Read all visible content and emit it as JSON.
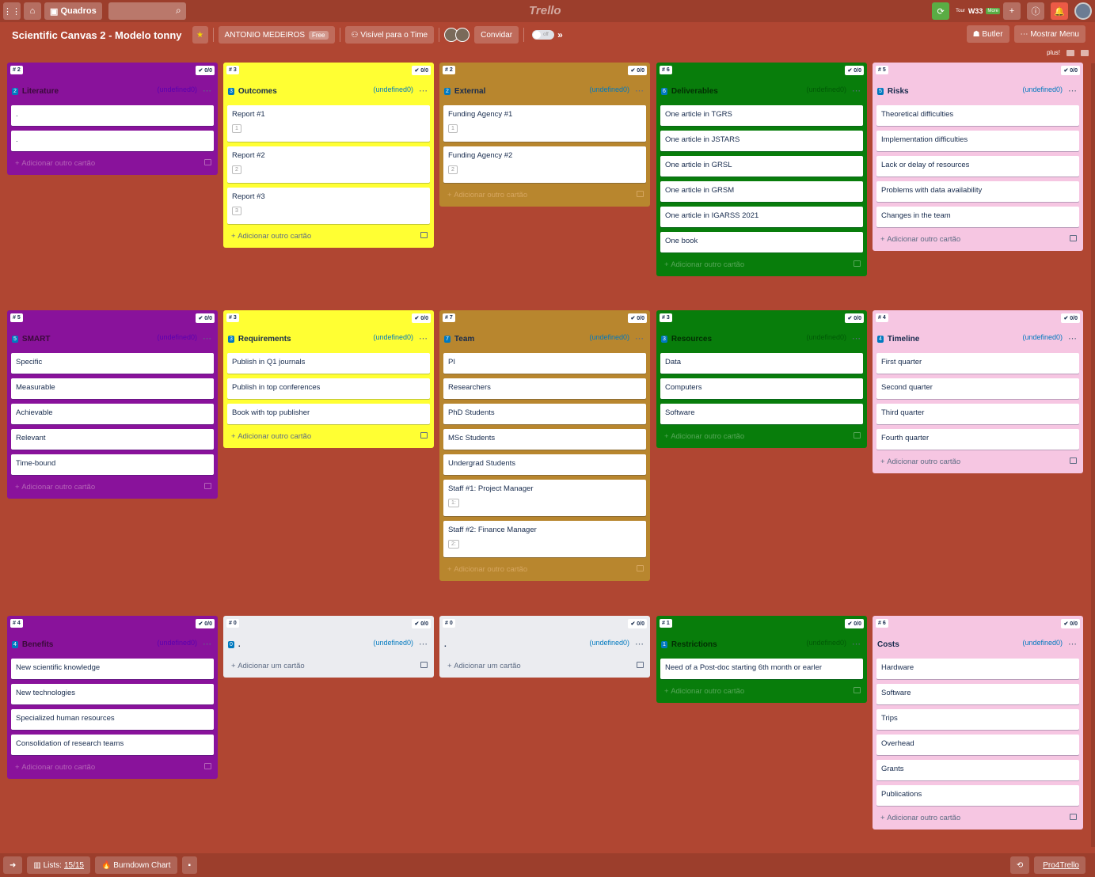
{
  "topbar": {
    "boards_label": "Quadros",
    "logo": "Trello",
    "tour": "Tour",
    "w33": "W33",
    "more": "More"
  },
  "header": {
    "title": "Scientific Canvas 2 - Modelo tonny",
    "team": "ANTONIO MEDEIROS",
    "free": "Free",
    "visibility": "Visível para o Time",
    "invite": "Convidar",
    "toggle": "off",
    "butler": "Butler",
    "menu": "Mostrar Menu",
    "plus": "plus!"
  },
  "add_card": "Adicionar outro cartão",
  "add_first": "Adicionar um cartão",
  "undefined": "(undefined0)",
  "lists": [
    {
      "num": "# 2",
      "check": "0/0",
      "count": "2",
      "name": "Literature",
      "cards": [
        {
          "t": "."
        },
        {
          "t": "."
        }
      ]
    },
    {
      "num": "# 3",
      "check": "0/0",
      "count": "3",
      "name": "Outcomes",
      "cards": [
        {
          "t": "Report #1",
          "b": "1"
        },
        {
          "t": "Report #2",
          "b": "2"
        },
        {
          "t": "Report #3",
          "b": "3"
        }
      ]
    },
    {
      "num": "# 2",
      "check": "0/0",
      "count": "2",
      "name": "External",
      "cards": [
        {
          "t": "Funding Agency #1",
          "b": "1"
        },
        {
          "t": "Funding Agency #2",
          "b": "2"
        }
      ]
    },
    {
      "num": "# 6",
      "check": "0/0",
      "count": "6",
      "name": "Deliverables",
      "cards": [
        {
          "t": "One article in TGRS"
        },
        {
          "t": "One article in JSTARS"
        },
        {
          "t": "One article in GRSL"
        },
        {
          "t": "One article in GRSM"
        },
        {
          "t": "One article in IGARSS 2021"
        },
        {
          "t": "One book"
        }
      ]
    },
    {
      "num": "# 5",
      "check": "0/0",
      "count": "5",
      "name": "Risks",
      "cards": [
        {
          "t": "Theoretical difficulties"
        },
        {
          "t": "Implementation difficulties"
        },
        {
          "t": "Lack or delay of resources"
        },
        {
          "t": "Problems with data availability"
        },
        {
          "t": "Changes in the team"
        }
      ]
    },
    {
      "num": "# 5",
      "check": "0/0",
      "count": "5",
      "name": "SMART",
      "cards": [
        {
          "t": "Specific"
        },
        {
          "t": "Measurable"
        },
        {
          "t": "Achievable"
        },
        {
          "t": "Relevant"
        },
        {
          "t": "Time-bound"
        }
      ]
    },
    {
      "num": "# 3",
      "check": "0/0",
      "count": "3",
      "name": "Requirements",
      "cards": [
        {
          "t": "Publish in Q1 journals"
        },
        {
          "t": "Publish in top conferences"
        },
        {
          "t": "Book with top publisher"
        }
      ]
    },
    {
      "num": "# 7",
      "check": "0/0",
      "count": "7",
      "name": "Team",
      "cards": [
        {
          "t": "PI"
        },
        {
          "t": "Researchers"
        },
        {
          "t": "PhD Students"
        },
        {
          "t": "MSc Students"
        },
        {
          "t": "Undergrad Students"
        },
        {
          "t": "Staff #1: Project Manager",
          "b": "1:"
        },
        {
          "t": "Staff #2: Finance Manager",
          "b": "2:"
        }
      ]
    },
    {
      "num": "# 3",
      "check": "0/0",
      "count": "3",
      "name": "Resources",
      "cards": [
        {
          "t": "Data"
        },
        {
          "t": "Computers"
        },
        {
          "t": "Software"
        }
      ]
    },
    {
      "num": "# 4",
      "check": "0/0",
      "count": "4",
      "name": "Timeline",
      "cards": [
        {
          "t": "First quarter"
        },
        {
          "t": "Second quarter"
        },
        {
          "t": "Third quarter"
        },
        {
          "t": "Fourth quarter"
        }
      ]
    },
    {
      "num": "# 4",
      "check": "0/0",
      "count": "4",
      "name": "Benefits",
      "cards": [
        {
          "t": "New scientific knowledge"
        },
        {
          "t": "New technologies"
        },
        {
          "t": "Specialized human resources"
        },
        {
          "t": "Consolidation of research teams"
        }
      ]
    },
    {
      "num": "# 0",
      "check": "0/0",
      "count": "0",
      "name": ".",
      "cards": []
    },
    {
      "num": "# 0",
      "check": "0/0",
      "count": "",
      "name": ".",
      "cards": []
    },
    {
      "num": "# 1",
      "check": "0/0",
      "count": "1",
      "name": "Restrictions",
      "cards": [
        {
          "t": "Need of a Post-doc starting 6th month or earler"
        }
      ]
    },
    {
      "num": "# 6",
      "check": "0/0",
      "count": "",
      "name": "Costs",
      "cards": [
        {
          "t": "Hardware"
        },
        {
          "t": "Software"
        },
        {
          "t": "Trips"
        },
        {
          "t": "Overhead"
        },
        {
          "t": "Grants"
        },
        {
          "t": "Publications"
        }
      ]
    }
  ],
  "bottom": {
    "lists_label": "Lists:",
    "lists_value": "15/15",
    "burndown": "Burndown Chart",
    "pro": "Pro4Trello"
  }
}
